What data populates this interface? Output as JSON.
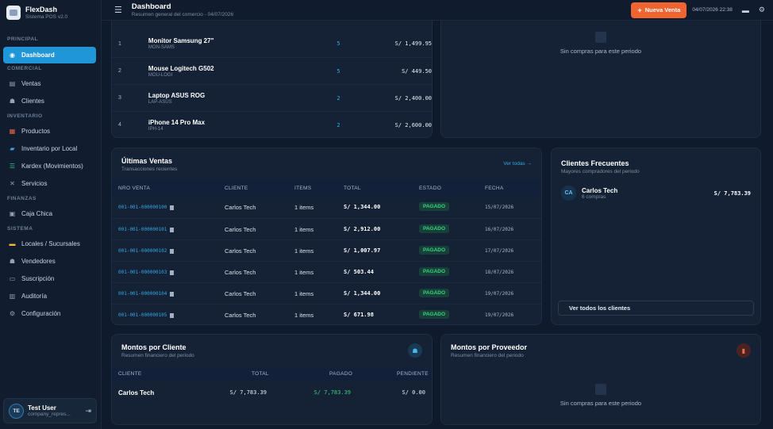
{
  "brand": {
    "name": "FlexDash",
    "subtitle": "Sistema POS v2.0"
  },
  "sidebar": {
    "sections": [
      {
        "title": "PRINCIPAL",
        "items": [
          {
            "label": "Dashboard",
            "icon": "dashboard-icon",
            "active": true
          }
        ]
      },
      {
        "title": "COMERCIAL",
        "items": [
          {
            "label": "Ventas",
            "icon": "receipt-icon"
          },
          {
            "label": "Clientes",
            "icon": "users-icon"
          }
        ]
      },
      {
        "title": "INVENTARIO",
        "items": [
          {
            "label": "Productos",
            "icon": "boxes-icon"
          },
          {
            "label": "Inventario por Local",
            "icon": "warehouse-icon"
          },
          {
            "label": "Kardex (Movimientos)",
            "icon": "list-icon"
          },
          {
            "label": "Servicios",
            "icon": "tools-icon"
          }
        ]
      },
      {
        "title": "FINANZAS",
        "items": [
          {
            "label": "Caja Chica",
            "icon": "cashbox-icon"
          }
        ]
      },
      {
        "title": "SISTEMA",
        "items": [
          {
            "label": "Locales / Sucursales",
            "icon": "store-icon"
          },
          {
            "label": "Vendedores",
            "icon": "vendors-icon"
          },
          {
            "label": "Suscripción",
            "icon": "card-icon"
          },
          {
            "label": "Auditoría",
            "icon": "audit-icon"
          },
          {
            "label": "Configuración",
            "icon": "settings-icon"
          }
        ]
      }
    ],
    "user": {
      "initials": "TE",
      "name": "Test User",
      "role": "company_repres..."
    }
  },
  "header": {
    "title": "Dashboard",
    "subtitle": "Resumen general del comercio - 04/07/2026",
    "new_sale_label": "Nueva Venta",
    "datetime": "04/07/2026 22:38"
  },
  "top_products": {
    "rows": [
      {
        "rank": "1",
        "name": "Monitor Samsung 27\"",
        "code": "MON-SAMS",
        "qty": "5",
        "amount": "S/ 1,499.95"
      },
      {
        "rank": "2",
        "name": "Mouse Logitech G502",
        "code": "MOU-LOGI",
        "qty": "5",
        "amount": "S/ 449.50"
      },
      {
        "rank": "3",
        "name": "Laptop ASUS ROG",
        "code": "LAP-ASUS",
        "qty": "2",
        "amount": "S/ 2,400.00"
      },
      {
        "rank": "4",
        "name": "iPhone 14 Pro Max",
        "code": "IPH-14",
        "qty": "2",
        "amount": "S/ 2,600.00"
      }
    ]
  },
  "purchases_empty": {
    "text": "Sin compras para este periodo"
  },
  "sales": {
    "title": "Últimas Ventas",
    "subtitle": "Transacciones recientes",
    "view_all": "Ver todas →",
    "columns": [
      "NRO VENTA",
      "CLIENTE",
      "ITEMS",
      "TOTAL",
      "ESTADO",
      "FECHA"
    ],
    "rows": [
      {
        "id": "001-001-000000100",
        "client": "Carlos Tech",
        "items": "1 items",
        "total": "S/ 1,344.00",
        "status": "PAGADO",
        "date": "15/07/2026"
      },
      {
        "id": "001-001-000000101",
        "client": "Carlos Tech",
        "items": "1 items",
        "total": "S/ 2,912.00",
        "status": "PAGADO",
        "date": "16/07/2026"
      },
      {
        "id": "001-001-000000102",
        "client": "Carlos Tech",
        "items": "1 items",
        "total": "S/ 1,007.97",
        "status": "PAGADO",
        "date": "17/07/2026"
      },
      {
        "id": "001-001-000000103",
        "client": "Carlos Tech",
        "items": "1 items",
        "total": "S/ 503.44",
        "status": "PAGADO",
        "date": "18/07/2026"
      },
      {
        "id": "001-001-000000104",
        "client": "Carlos Tech",
        "items": "1 items",
        "total": "S/ 1,344.00",
        "status": "PAGADO",
        "date": "19/07/2026"
      },
      {
        "id": "001-001-000000105",
        "client": "Carlos Tech",
        "items": "1 items",
        "total": "S/ 671.98",
        "status": "PAGADO",
        "date": "19/07/2026"
      }
    ]
  },
  "frequent_clients": {
    "title": "Clientes Frecuentes",
    "subtitle": "Mayores compradores del periodo",
    "client": {
      "initials": "CA",
      "name": "Carlos Tech",
      "purchases": "6 compras",
      "amount": "S/ 7,783.39"
    },
    "view_all": "Ver todos los clientes"
  },
  "amounts_client": {
    "title": "Montos por Cliente",
    "subtitle": "Resumen financiero del periodo",
    "columns": [
      "CLIENTE",
      "TOTAL",
      "PAGADO",
      "PENDIENTE"
    ],
    "row": {
      "client": "Carlos Tech",
      "total": "S/ 7,783.39",
      "paid": "S/ 7,783.39",
      "pending": "S/ 0.00"
    }
  },
  "amounts_provider": {
    "title": "Montos por Proveedor",
    "subtitle": "Resumen financiero del periodo",
    "empty": "Sin compras para este periodo"
  },
  "colors": {
    "accent": "#1e96d8",
    "cta": "#ef6430",
    "paid": "#37d27a"
  }
}
